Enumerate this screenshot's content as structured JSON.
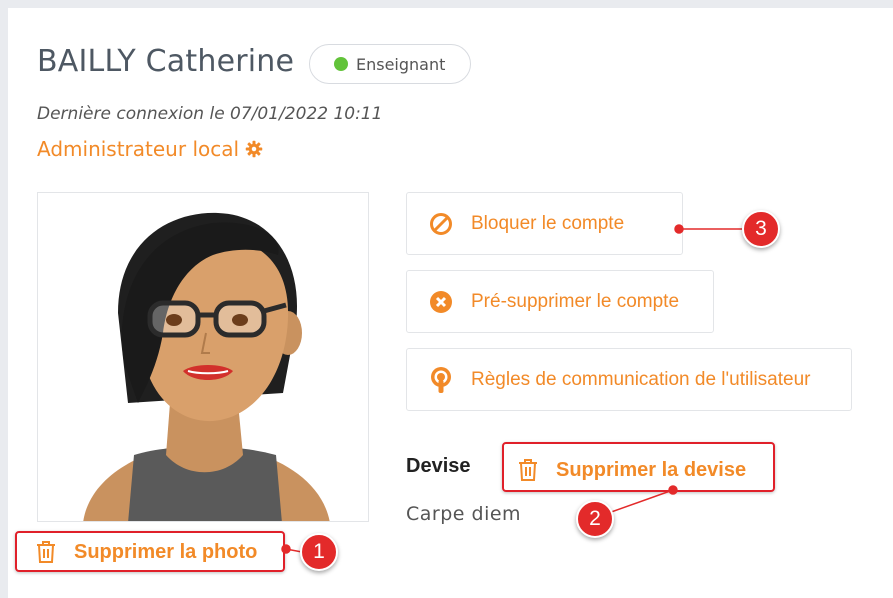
{
  "user": {
    "name": "BAILLY Catherine",
    "role_badge": "Enseignant",
    "last_login": "Dernière connexion le 07/01/2022 10:11",
    "admin_link": "Administrateur local"
  },
  "actions": {
    "block": "Bloquer le compte",
    "predelete": "Pré-supprimer le compte",
    "rules": "Règles de communication de l'utilisateur"
  },
  "devise": {
    "label": "Devise",
    "delete": "Supprimer la devise",
    "text": "Carpe diem"
  },
  "photo": {
    "delete": "Supprimer la photo"
  },
  "callouts": [
    "1",
    "2",
    "3"
  ],
  "colors": {
    "accent": "#f28a28",
    "status_active": "#62c33a",
    "highlight": "#e0202a"
  }
}
